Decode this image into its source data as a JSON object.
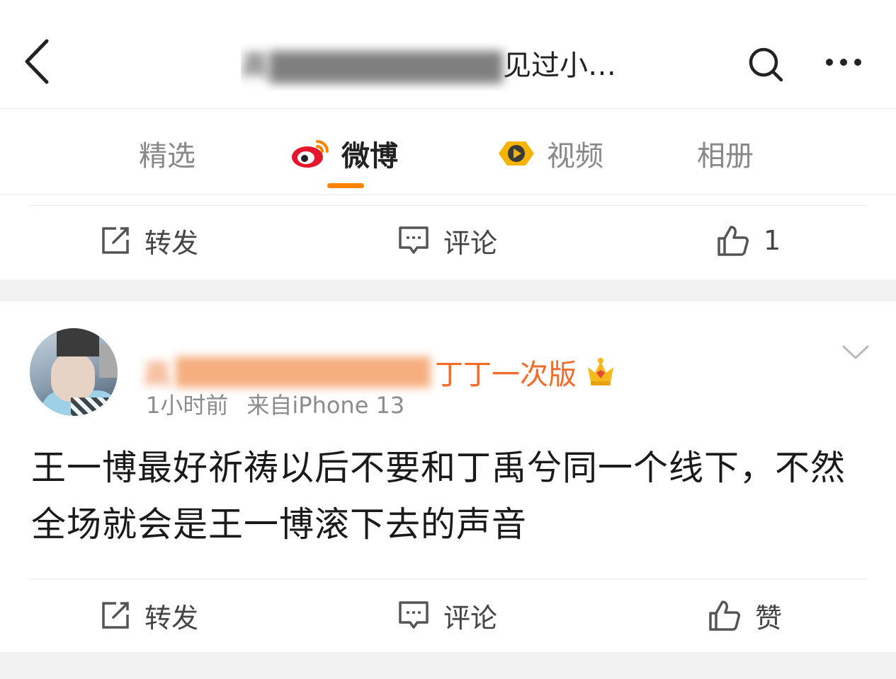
{
  "header": {
    "back_icon": "chevron-left-icon",
    "title_obscured": "高",
    "title_visible": "见过小…",
    "search_icon": "search-icon",
    "more_icon": "more-dots-icon"
  },
  "tabs": [
    {
      "label": "精选",
      "icon": null,
      "active": false
    },
    {
      "label": "微博",
      "icon": "weibo-logo-icon",
      "active": true
    },
    {
      "label": "视频",
      "icon": "video-badge-icon",
      "active": false
    },
    {
      "label": "相册",
      "icon": null,
      "active": false
    }
  ],
  "colors": {
    "accent": "#ff8200",
    "username": "#f26b2a",
    "meta_text": "#8c8c8c",
    "band": "#f2f2f2"
  },
  "prev_post_actions": {
    "repost_label": "转发",
    "comment_label": "评论",
    "like_label": "1"
  },
  "post": {
    "username_obscured": "高",
    "username_visible": "丁丁一次版",
    "badge_icon": "crown-icon",
    "time": "1小时前",
    "source": "来自iPhone 13",
    "text": "王一博最好祈祷以后不要和丁禹兮同一个线下，不然全场就会是王一博滚下去的声音",
    "actions": {
      "repost_label": "转发",
      "comment_label": "评论",
      "like_label": "赞"
    }
  }
}
